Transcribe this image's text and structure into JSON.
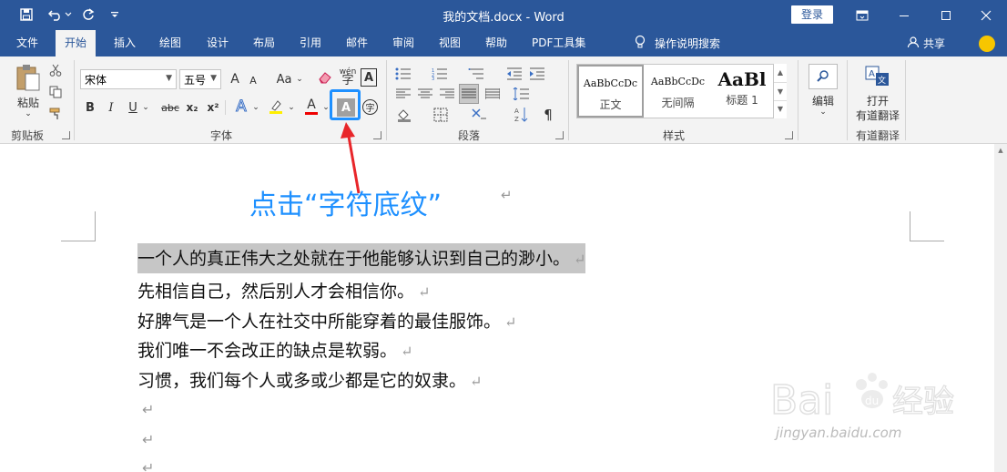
{
  "window": {
    "title": "我的文档.docx  -  Word",
    "login_label": "登录"
  },
  "tabs": [
    "文件",
    "开始",
    "插入",
    "绘图",
    "设计",
    "布局",
    "引用",
    "邮件",
    "审阅",
    "视图",
    "帮助",
    "PDF工具集"
  ],
  "active_tab": "开始",
  "search": {
    "label": "操作说明搜索"
  },
  "share": {
    "label": "共享"
  },
  "ribbon": {
    "clipboard": {
      "paste_label": "粘贴",
      "group_label": "剪贴板"
    },
    "font": {
      "font_name": "宋体",
      "font_size": "五号",
      "grow_label": "A",
      "shrink_label": "A",
      "case_label": "Aa",
      "phonetic_label": "wén",
      "bold": "B",
      "italic": "I",
      "underline": "U",
      "strike": "abc",
      "subscript": "x₂",
      "superscript": "x²",
      "shading_label": "A",
      "enclose_label": "字",
      "group_label": "字体"
    },
    "paragraph": {
      "group_label": "段落"
    },
    "styles": {
      "items": [
        {
          "sample": "AaBbCcDc",
          "name": "正文"
        },
        {
          "sample": "AaBbCcDc",
          "name": "无间隔"
        },
        {
          "sample": "AaBl",
          "name": "标题 1"
        }
      ],
      "group_label": "样式"
    },
    "editing": {
      "label": "编辑"
    },
    "translate": {
      "label_line1": "打开",
      "label_line2": "有道翻译",
      "group_label": "有道翻译"
    }
  },
  "annotation": {
    "text": "点击“字符底纹”"
  },
  "document": {
    "lines": [
      "一个人的真正伟大之处就在于他能够认识到自己的渺小。",
      "先相信自己，然后别人才会相信你。",
      "好脾气是一个人在社交中所能穿着的最佳服饰。",
      "我们唯一不会改正的缺点是软弱。",
      "习惯，我们每个人或多或少都是它的奴隶。"
    ],
    "paragraph_mark": "↵"
  },
  "watermark": {
    "brand": "Bai",
    "brand_suffix": "du",
    "cn": "经验",
    "url": "jingyan.baidu.com"
  },
  "colors": {
    "brand": "#2b579a",
    "annotation": "#1e90ff",
    "arrow": "#e8262a"
  }
}
